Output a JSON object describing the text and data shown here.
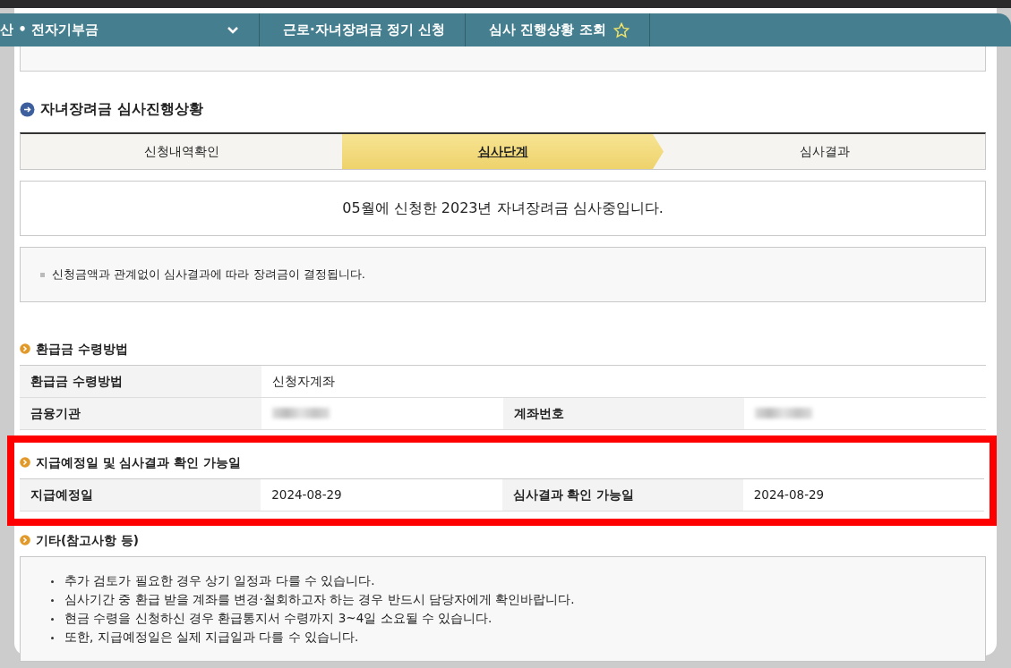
{
  "breadcrumb": [
    {
      "label": "산 • 전자기부금",
      "kind": "dropdown"
    },
    {
      "label": "근로·자녀장려금 정기 신청",
      "kind": "plain"
    },
    {
      "label": "심사 진행상황 조회",
      "kind": "favorite"
    }
  ],
  "progress": {
    "title": "자녀장려금 심사진행상황",
    "steps": [
      {
        "label": "신청내역확인",
        "selected": false
      },
      {
        "label": "심사단계",
        "selected": true
      },
      {
        "label": "심사결과",
        "selected": false
      }
    ],
    "message": "05월에 신청한 2023년 자녀장려금 심사중입니다.",
    "note": "신청금액과 관계없이 심사결과에 따라 장려금이 결정됩니다."
  },
  "refund": {
    "title": "환급금 수령방법",
    "rows": [
      [
        {
          "label": "환급금 수령방법",
          "value": "신청자계좌"
        }
      ],
      [
        {
          "label": "금융기관",
          "hidden": true
        },
        {
          "label": "계좌번호",
          "hidden": true
        }
      ]
    ]
  },
  "schedule": {
    "title": "지급예정일 및 심사결과 확인 가능일",
    "highlighted": true,
    "rows": [
      [
        {
          "label": "지급예정일",
          "value": "2024-08-29"
        },
        {
          "label": "심사결과 확인 가능일",
          "value": "2024-08-29"
        }
      ]
    ]
  },
  "other": {
    "title": "기타(참고사항 등)",
    "notes": [
      "추가 검토가 필요한 경우 상기 일정과 다를 수 있습니다.",
      "심사기간 중 환급 받을 계좌를 변경·철회하고자 하는 경우 반드시 담당자에게 확인바랍니다.",
      "현금 수령을 신청하신 경우 환급통지서 수령까지 3~4일 소요될 수 있습니다.",
      "또한, 지급예정일은 실제 지급일과 다를 수 있습니다."
    ]
  }
}
